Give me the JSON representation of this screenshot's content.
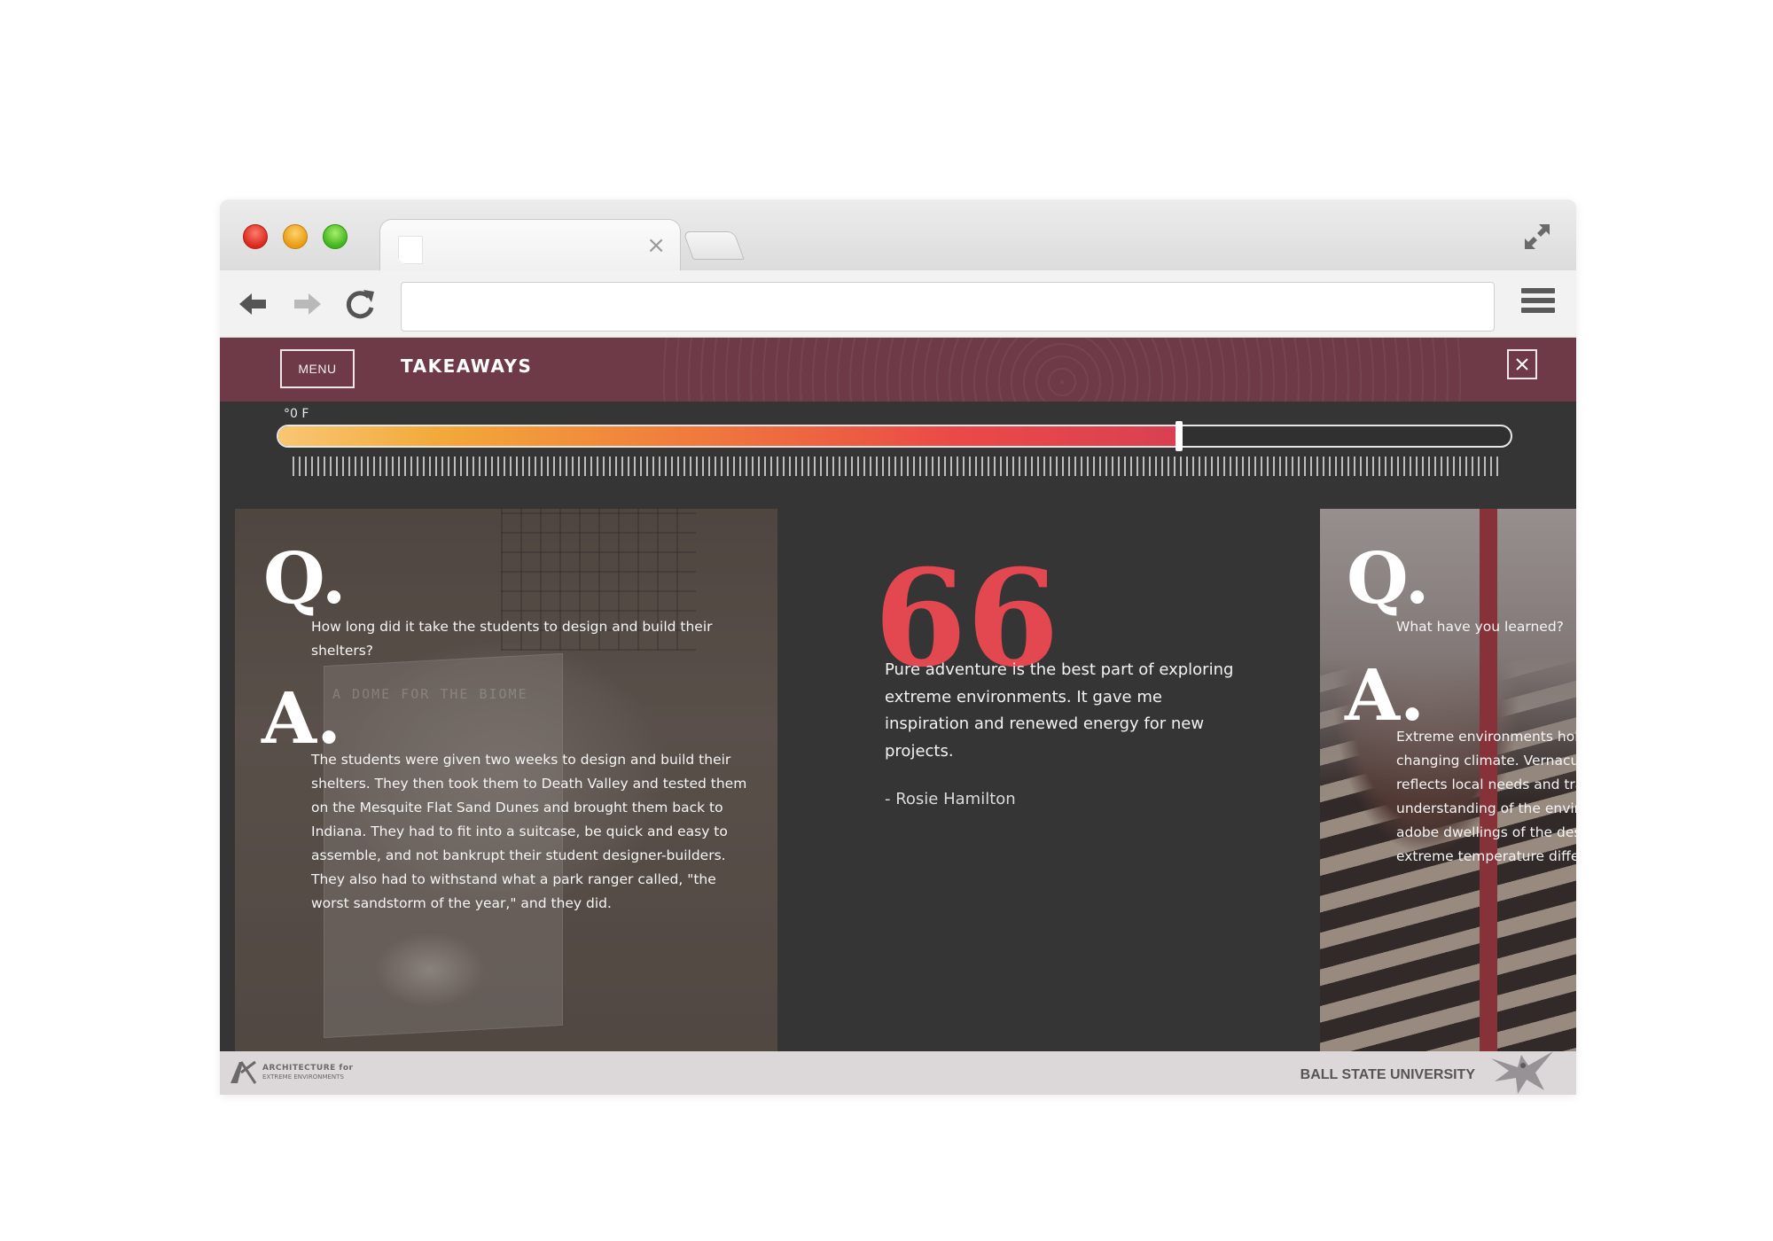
{
  "browser": {
    "tab": {
      "title": "",
      "close_glyph": "×"
    },
    "address_bar": {
      "value": ""
    }
  },
  "site": {
    "header": {
      "menu_label": "MENU",
      "title": "TAKEAWAYS",
      "close_glyph": "×"
    },
    "temperature": {
      "label": "°0 F",
      "level_percent": 73
    },
    "cards": {
      "left": {
        "q_letter": "Q.",
        "question": "How long did it take the students to design and build their shelters?",
        "a_letter": "A.",
        "answer": "The students were given two weeks to design and build their shelters. They then took them to Death Valley and tested them on the Mesquite Flat Sand Dunes and brought them back to Indiana. They had to fit into a suitcase, be quick and easy to assemble, and not bankrupt their student designer-builders. They also had to withstand what a park ranger called, \"the worst sandstorm of the year,\" and they did.",
        "poster_title": "A DOME FOR THE BIOME"
      },
      "quote": {
        "mark": "66",
        "text": "Pure adventure is the best part of exploring extreme environments. It gave me inspiration and renewed energy for new projects.",
        "author": "- Rosie Hamilton"
      },
      "right": {
        "q_letter": "Q.",
        "question": "What have you learned?",
        "a_letter": "A.",
        "answer_lines": [
          "Extreme environments hold",
          "changing climate. Vernacu",
          "reflects local needs and tra",
          "understanding of the envir",
          "adobe dwellings of the des",
          "extreme temperature differ"
        ]
      }
    },
    "footer": {
      "logo_line1": "ARCHITECTURE for",
      "logo_line2": "EXTREME ENVIRONMENTS",
      "university": "BALL STATE UNIVERSITY"
    }
  },
  "colors": {
    "header_bg": "#6e3a48",
    "content_bg": "#353535",
    "quote_accent": "#e3474f",
    "footer_bg": "#dcd8d9"
  },
  "icons": [
    "close-icon",
    "back-arrow-icon",
    "forward-arrow-icon",
    "reload-icon",
    "expand-icon",
    "hamburger-menu-icon",
    "quote-icon",
    "cardinal-logo-icon",
    "ax-logo-icon"
  ]
}
